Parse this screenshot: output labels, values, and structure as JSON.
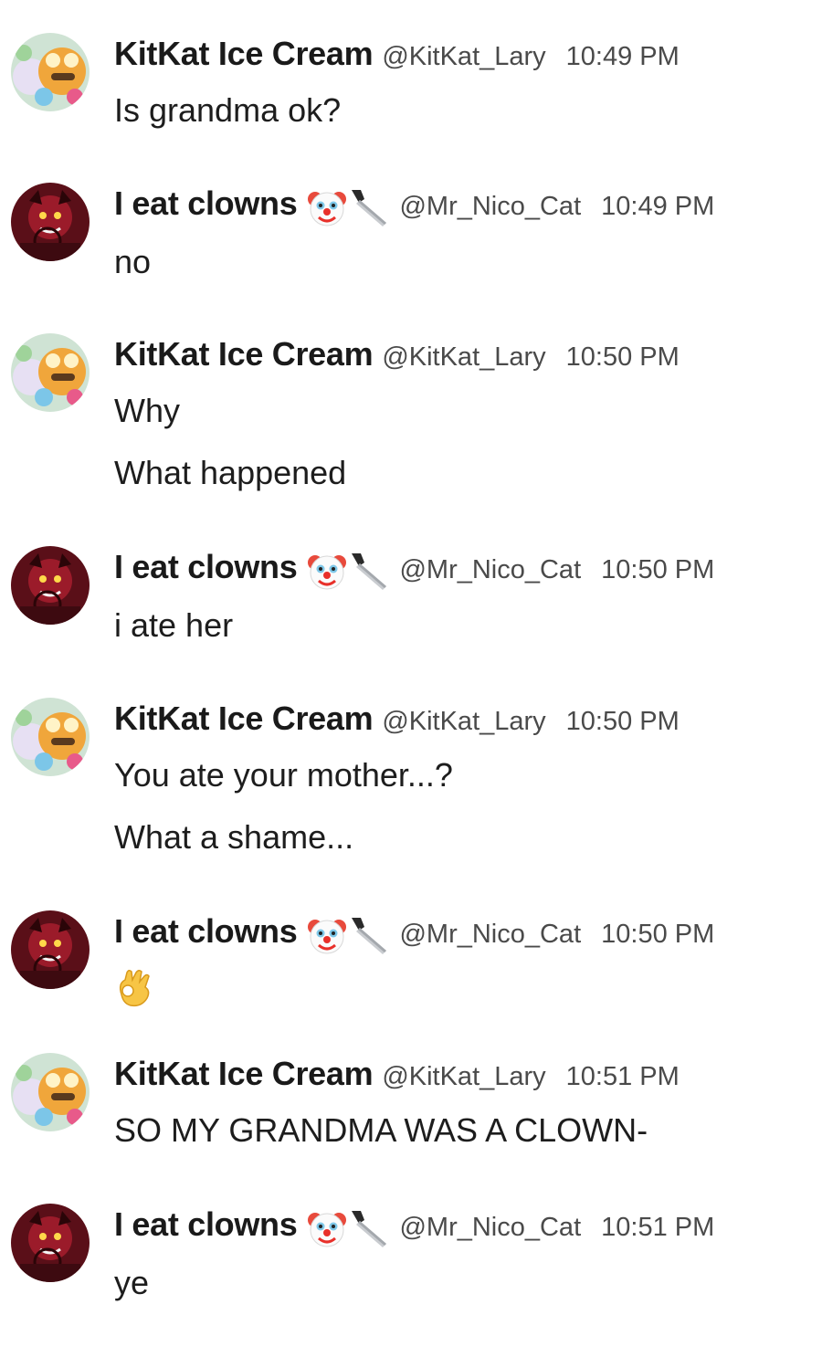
{
  "users": {
    "kitkat": {
      "display_name": "KitKat Ice Cream",
      "handle": "@KitKat_Lary",
      "avatar": "animatronic-bear-avatar"
    },
    "nico": {
      "display_name": "I eat clowns",
      "name_emojis": [
        "clown-face-emoji",
        "kitchen-knife-emoji"
      ],
      "handle": "@Mr_Nico_Cat",
      "avatar": "red-demon-avatar"
    }
  },
  "messages": [
    {
      "author": "kitkat",
      "time": "10:49 PM",
      "lines": [
        "Is grandma ok?"
      ]
    },
    {
      "author": "nico",
      "time": "10:49 PM",
      "lines": [
        "no"
      ]
    },
    {
      "author": "kitkat",
      "time": "10:50 PM",
      "lines": [
        "Why",
        "What happened"
      ]
    },
    {
      "author": "nico",
      "time": "10:50 PM",
      "lines": [
        "i ate her"
      ]
    },
    {
      "author": "kitkat",
      "time": "10:50 PM",
      "lines": [
        "You ate your mother...?",
        "What a shame..."
      ]
    },
    {
      "author": "nico",
      "time": "10:50 PM",
      "lines": [],
      "emoji": "ok-hand-emoji"
    },
    {
      "author": "kitkat",
      "time": "10:51 PM",
      "lines": [
        "SO MY GRANDMA WAS A CLOWN-"
      ]
    },
    {
      "author": "nico",
      "time": "10:51 PM",
      "lines": [
        "ye"
      ]
    }
  ],
  "colors": {
    "background": "#ffffff",
    "name_text": "#1a1a1a",
    "meta_text": "#4a4a4a",
    "message_text": "#1d1d1d"
  }
}
